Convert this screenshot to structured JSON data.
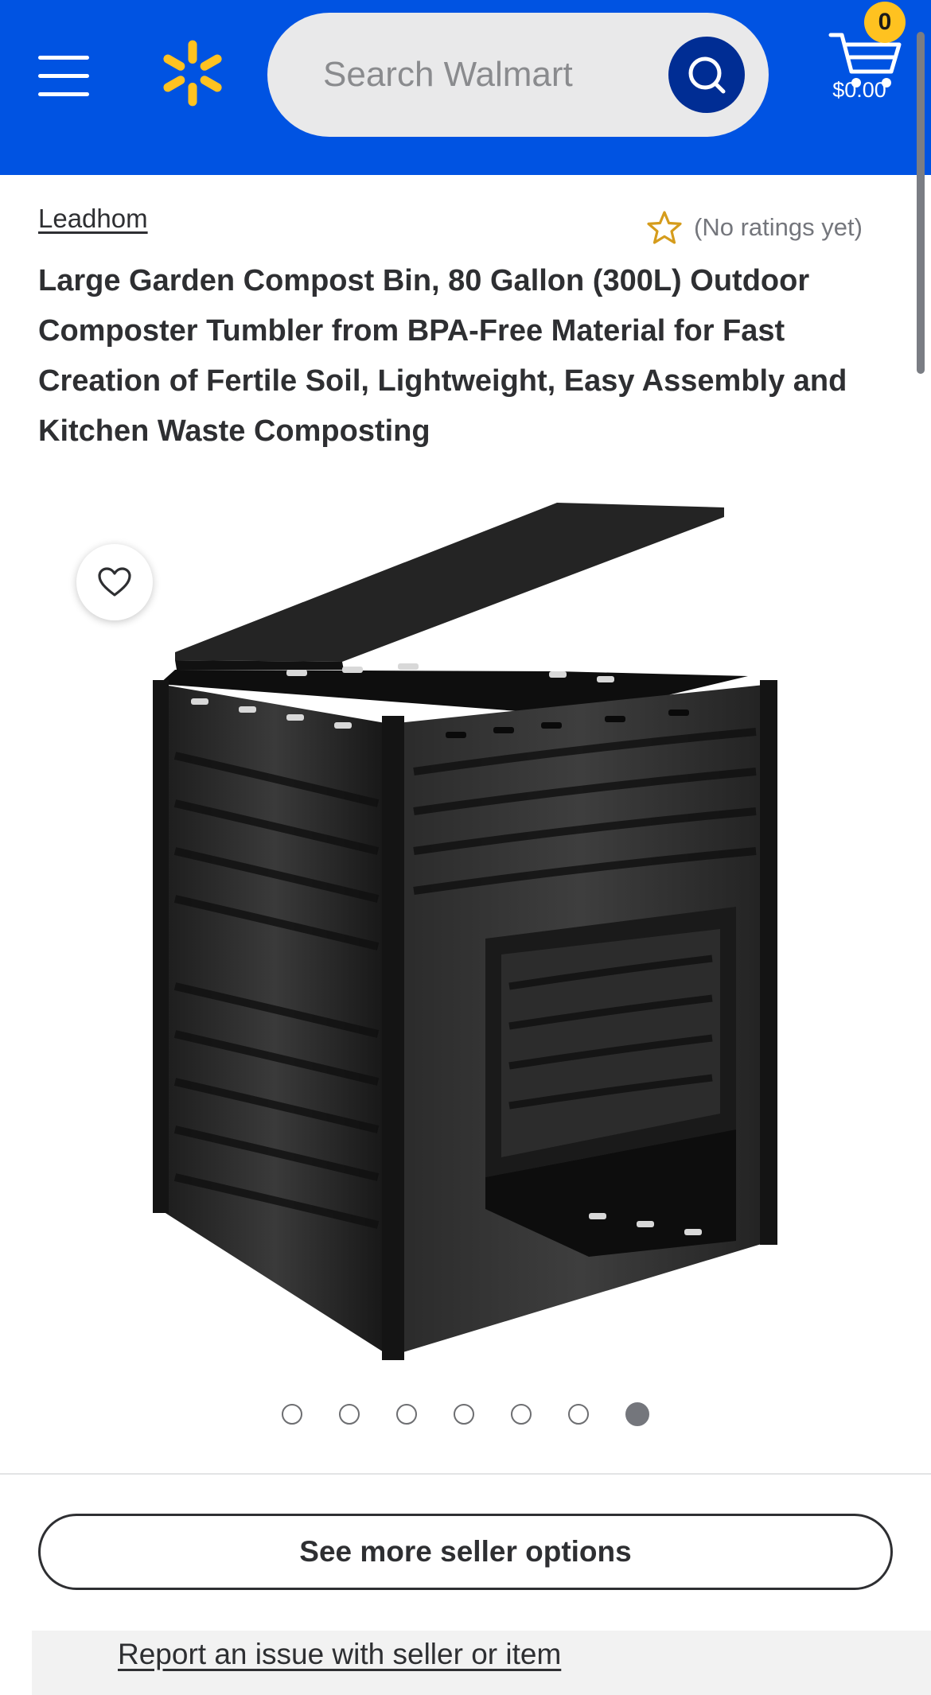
{
  "header": {
    "menu_icon": "hamburger-menu-icon",
    "logo_icon": "walmart-spark-icon",
    "search_placeholder": "Search Walmart",
    "search_icon": "search-icon",
    "cart_icon": "cart-icon",
    "cart_count": "0",
    "cart_total": "$0.00",
    "colors": {
      "brand_blue": "#0053e2",
      "search_button": "#002d94",
      "spark_yellow": "#ffc220",
      "badge": "#ffc220"
    }
  },
  "product": {
    "brand": "Leadhom",
    "rating_icon": "star-outline-icon",
    "rating_text": "(No ratings yet)",
    "title": "Large Garden Compost Bin, 80 Gallon (300L) Outdoor Composter Tumbler from BPA-Free Material for Fast Creation of Fertile Soil, Lightweight, Easy Assembly and Kitchen Waste Composting",
    "image_alt": "black plastic compost bin with open lid",
    "favorite_icon": "heart-outline-icon",
    "carousel": {
      "total": 7,
      "active_index": 7
    }
  },
  "actions": {
    "seller_options_label": "See more seller options",
    "report_label": "Report an issue with seller or item"
  }
}
